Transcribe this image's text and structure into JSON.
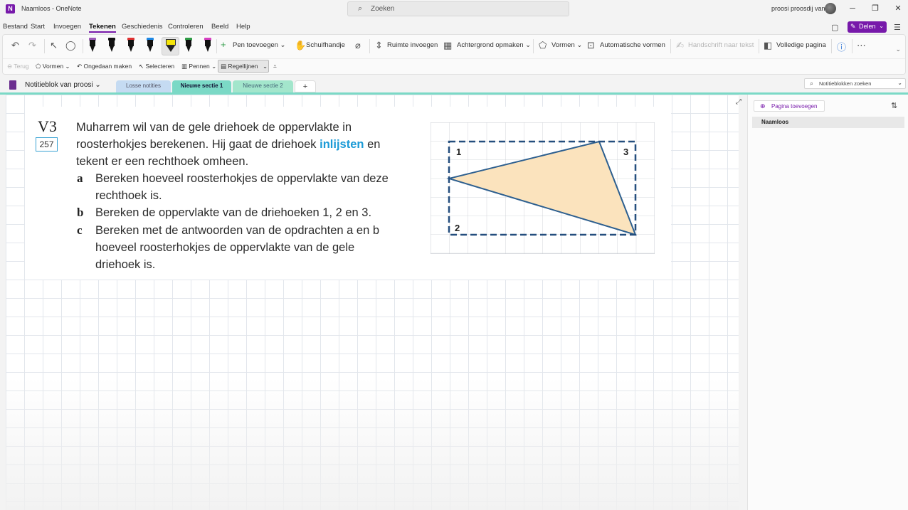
{
  "window": {
    "title": "Naamloos - OneNote",
    "search_placeholder": "Zoeken",
    "user": "proosi proosdij van",
    "logo_letter": "N"
  },
  "menu": [
    "Bestand",
    "Start",
    "Invoegen",
    "Tekenen",
    "Geschiedenis",
    "Controleren",
    "Beeld",
    "Help"
  ],
  "share_label": "Delen",
  "ribbon": {
    "add_pen": "Pen toevoegen",
    "hand": "Schuifhandje",
    "insert_space": "Ruimte invoegen",
    "background": "Achtergrond opmaken",
    "shapes": "Vormen",
    "auto_shapes": "Automatische vormen",
    "ink_to_text": "Handschrift naar tekst",
    "full_page": "Volledige pagina"
  },
  "ribbon2": {
    "back": "Terug",
    "shapes": "Vormen",
    "undo": "Ongedaan maken",
    "select": "Selecteren",
    "pens": "Pennen",
    "rule_lines": "Regellijnen"
  },
  "notebook": "Notitieblok van proosi",
  "sections": [
    {
      "label": "Losse notities",
      "color": "#c5dbf2"
    },
    {
      "label": "Nieuwe sectie 1",
      "color": "#7bd9c6"
    },
    {
      "label": "Nieuwe sectie 2",
      "color": "#a3e6cc"
    }
  ],
  "add_section": "+",
  "notebook_search": "Notitieblokken zoeken",
  "exercise": {
    "number": "V3",
    "page": "257",
    "intro": [
      "Muharrem wil van de gele driehoek de oppervlakte in",
      "roosterhokjes berekenen. Hij gaat de driehoek ",
      "inlijsten",
      " en",
      "tekent er een rechthoek omheen."
    ],
    "items": [
      {
        "letter": "a",
        "lines": [
          "Bereken hoeveel roosterhokjes de oppervlakte van deze",
          "rechthoek is."
        ]
      },
      {
        "letter": "b",
        "lines": [
          "Bereken de oppervlakte van de driehoeken 1, 2 en 3."
        ]
      },
      {
        "letter": "c",
        "lines": [
          "Bereken met de antwoorden van de opdrachten a en b",
          "hoeveel roosterhokjes de oppervlakte van de gele",
          "driehoek is."
        ]
      }
    ],
    "figure_labels": [
      "1",
      "2",
      "3"
    ]
  },
  "right_panel": {
    "add_page": "Pagina toevoegen",
    "pages": [
      "Naamloos"
    ]
  }
}
